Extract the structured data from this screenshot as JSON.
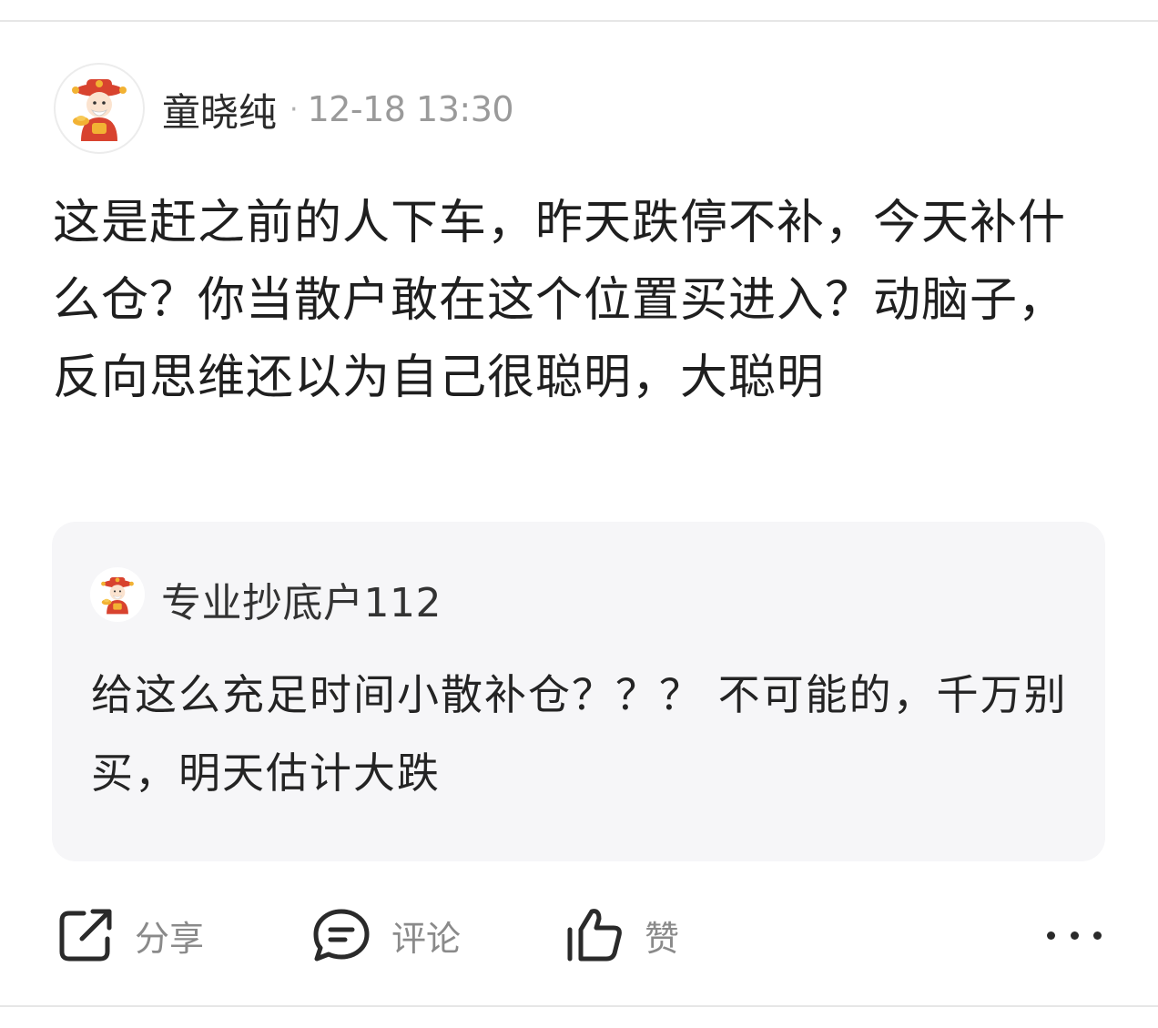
{
  "post": {
    "author": "童晓纯",
    "separator": "·",
    "timestamp": "12-18 13:30",
    "body": "这是赶之前的人下车，昨天跌停不补，今天补什么仓？你当散户敢在这个位置买进入？动脑子，反向思维还以为自己很聪明，大聪明"
  },
  "quoted": {
    "author": "专业抄底户112",
    "body": "给这么充足时间小散补仓？？？ 不可能的，千万别买，明天估计大跌"
  },
  "actions": {
    "share": "分享",
    "comment": "评论",
    "like": "赞"
  },
  "icons": {
    "avatar": "mascot-avatar-icon",
    "share": "share-icon",
    "comment": "comment-icon",
    "like": "thumbs-up-icon",
    "more": "more-icon"
  },
  "colors": {
    "quote_background": "#f6f6f8",
    "secondary_text": "#8a8a8a",
    "mascot_red": "#d8432f",
    "mascot_gold": "#f2b233"
  }
}
